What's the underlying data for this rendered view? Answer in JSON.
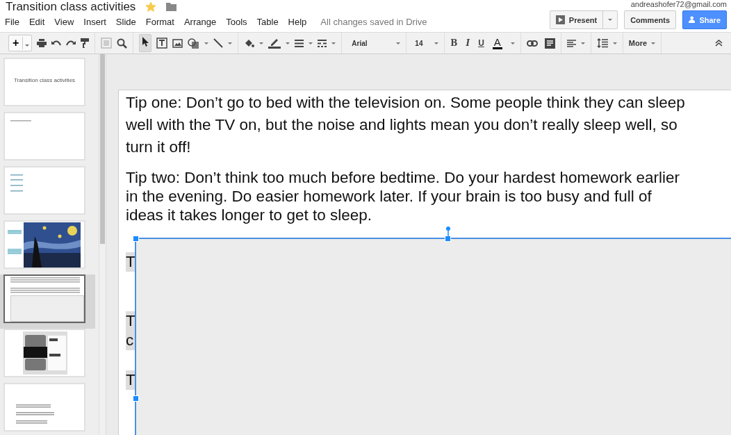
{
  "window": {
    "title": "Transition class activities",
    "starred": true,
    "account": "andreashofer72@gmail.com",
    "save_status": "All changes saved in Drive"
  },
  "menu": [
    "File",
    "Edit",
    "View",
    "Insert",
    "Slide",
    "Format",
    "Arrange",
    "Tools",
    "Table",
    "Help"
  ],
  "header_buttons": {
    "present": "Present",
    "comments": "Comments",
    "share": "Share"
  },
  "toolbar": {
    "new_slide": "+",
    "font": "Arial",
    "size": "14",
    "bold": "B",
    "italic": "I",
    "underline": "U",
    "text_color": "A",
    "more": "More"
  },
  "slides": [
    {
      "kind": "title",
      "title": "Transition class activities",
      "selected": false
    },
    {
      "kind": "heading",
      "selected": false
    },
    {
      "kind": "list",
      "selected": false
    },
    {
      "kind": "picture",
      "selected": false
    },
    {
      "kind": "text",
      "selected": true
    },
    {
      "kind": "poster",
      "selected": false
    },
    {
      "kind": "dialogue",
      "selected": false
    }
  ],
  "slide": {
    "paragraphs": [
      {
        "lines": [
          "Tip one: Don’t go to bed with the television on. Some people think they can sleep",
          "well with the TV on, but the noise and lights mean you don’t really sleep well, so",
          "turn it off!"
        ]
      },
      {
        "lines": [
          "Tip two: Don’t think too much before bedtime. Do your hardest homework earlier",
          "in the evening. Do easier homework later. If your brain is too busy and full of",
          "ideas it takes longer to get to sleep."
        ]
      }
    ],
    "covered": [
      [
        "T"
      ],
      [
        "T",
        "c"
      ],
      [
        "T"
      ]
    ]
  }
}
